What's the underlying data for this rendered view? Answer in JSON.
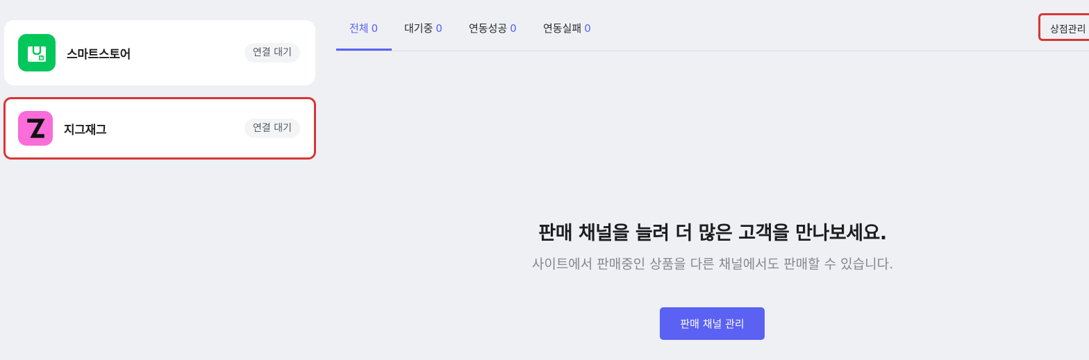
{
  "channels": [
    {
      "name": "스마트스토어",
      "status": "연결 대기",
      "icon": "smartstore-bag-icon",
      "color": "#03c75a"
    },
    {
      "name": "지그재그",
      "status": "연결 대기",
      "icon": "zigzag-z-icon",
      "color": "#f96cd9"
    }
  ],
  "tabs": [
    {
      "label": "전체",
      "count": "0",
      "active": true
    },
    {
      "label": "대기중",
      "count": "0",
      "active": false
    },
    {
      "label": "연동성공",
      "count": "0",
      "active": false
    },
    {
      "label": "연동실패",
      "count": "0",
      "active": false
    }
  ],
  "header": {
    "store_manage_label": "상점관리"
  },
  "empty_state": {
    "title": "판매 채널을 늘려 더 많은 고객을 만나보세요.",
    "subtitle": "사이트에서 판매중인 상품을 다른 채널에서도 판매할 수 있습니다.",
    "button_label": "판매 채널 관리"
  },
  "colors": {
    "accent": "#5b61f3",
    "highlight_border": "#d93535",
    "background": "#eef0f4"
  }
}
